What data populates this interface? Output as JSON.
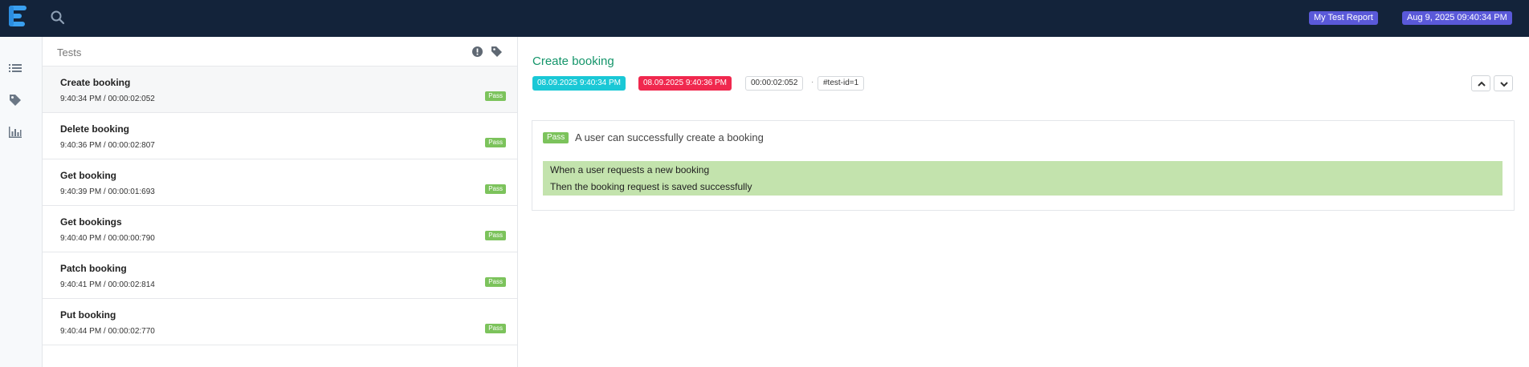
{
  "topbar": {
    "report_name": "My Test Report",
    "timestamp": "Aug 9, 2025 09:40:34 PM"
  },
  "rail": {
    "icons": [
      "list-icon",
      "tag-icon",
      "bar-chart-icon"
    ]
  },
  "list": {
    "title": "Tests",
    "header_icons": [
      "exclamation-icon",
      "tag-icon"
    ],
    "tests": [
      {
        "name": "Create booking",
        "meta": "9:40:34 PM / 00:00:02:052",
        "status": "Pass"
      },
      {
        "name": "Delete booking",
        "meta": "9:40:36 PM / 00:00:02:807",
        "status": "Pass"
      },
      {
        "name": "Get booking",
        "meta": "9:40:39 PM / 00:00:01:693",
        "status": "Pass"
      },
      {
        "name": "Get bookings",
        "meta": "9:40:40 PM / 00:00:00:790",
        "status": "Pass"
      },
      {
        "name": "Patch booking",
        "meta": "9:40:41 PM / 00:00:02:814",
        "status": "Pass"
      },
      {
        "name": "Put booking",
        "meta": "9:40:44 PM / 00:00:02:770",
        "status": "Pass"
      }
    ]
  },
  "detail": {
    "title": "Create booking",
    "start_time": "08.09.2025 9:40:34 PM",
    "end_time": "08.09.2025 9:40:36 PM",
    "duration": "00:00:02:052",
    "separator": "·",
    "test_id": "#test-id=1",
    "scenario": {
      "status": "Pass",
      "title": "A user can successfully create a booking",
      "steps": [
        "When a user requests a new booking",
        "Then the booking request is saved successfully"
      ]
    }
  },
  "colors": {
    "topbar": "#13233a",
    "accent": "#5a59d9",
    "pass": "#7cc35c",
    "start_tag": "#1ac8d6",
    "end_tag": "#f0284e",
    "title_green": "#14956a",
    "steps_bg": "#c3e3ad"
  }
}
